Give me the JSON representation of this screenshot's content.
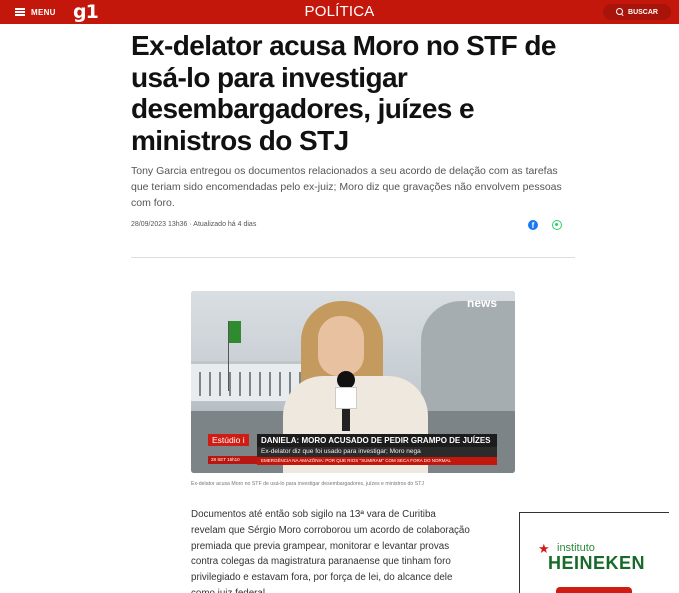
{
  "header": {
    "menu_label": "MENU",
    "logo": "g1",
    "section": "POLÍTICA",
    "search_label": "BUSCAR"
  },
  "article": {
    "headline": "Ex-delator acusa Moro no STF de usá-lo para investigar desembargadores, juízes e ministros do STJ",
    "subtitle": "Tony Garcia entregou os documentos relacionados a seu acordo de delação com as tarefas que teriam sido encomendadas pelo ex-juiz; Moro diz que gravações não envolvem pessoas com foro.",
    "dateline": "28/09/2023 13h36 · Atualizado há 4 dias",
    "video": {
      "logo": "news",
      "estudio": "Estúdio i",
      "gc_title": "DANIELA: MORO ACUSADO DE PEDIR GRAMPO DE JUÍZES",
      "gc_subtitle": "Ex-delator diz que foi usado para investigar; Moro nega",
      "date_chip": "28 SET   15h10",
      "ticker": "EMERGÊNCIA NA AMAZÔNIA: POR QUE RIOS \"SUMIRAM\" COM SECA FORA DO NORMAL"
    },
    "caption": "Ex-delator acusa Moro no STF de usá-lo para investigar desembargadores, juízes e ministros do STJ",
    "body": "Documentos até então sob sigilo na 13ª vara de Curitiba revelam que Sérgio Moro corroborou um acordo de colaboração premiada que previa grampear, monitorar e levantar provas contra colegas da magistratura paranaense que tinham foro privilegiado e estavam fora, por força de lei, do alcance dele como juiz federal."
  },
  "ad": {
    "top_text": "instituto",
    "brand": "HEINEKEN"
  },
  "icons": [
    "hamburger-icon",
    "search-icon",
    "facebook-icon",
    "whatsapp-icon",
    "star-icon"
  ],
  "colors": {
    "brand_red": "#c4170c",
    "facebook": "#1877f2",
    "whatsapp": "#25d366",
    "heineken_green": "#166b2a"
  }
}
